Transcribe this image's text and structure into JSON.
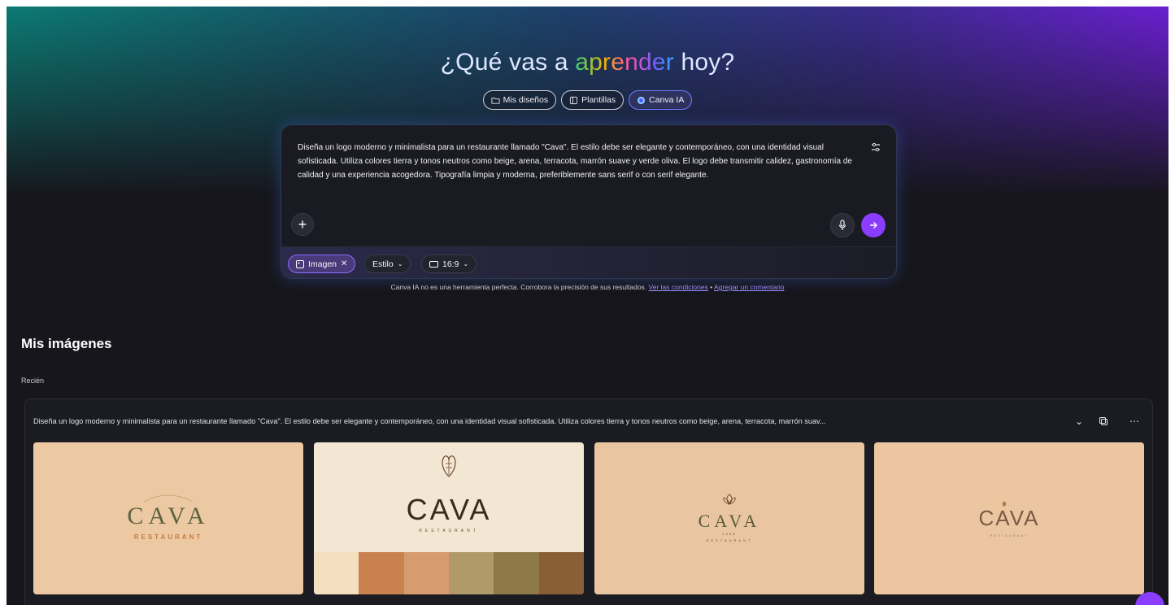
{
  "hero": {
    "headline_prefix": "¿Qué vas a ",
    "headline_accent": "aprender",
    "headline_suffix": " hoy?"
  },
  "tabs": [
    {
      "label": "Mis diseños",
      "icon": "folder-icon"
    },
    {
      "label": "Plantillas",
      "icon": "template-icon"
    },
    {
      "label": "Canva IA",
      "icon": "canva-ai-icon",
      "active": true
    }
  ],
  "prompt": {
    "text": "Diseña un logo moderno y minimalista para un restaurante llamado \"Cava\". El estilo debe ser elegante y contemporáneo, con una identidad visual sofisticada. Utiliza colores tierra y tonos neutros como beige, arena, terracota, marrón suave y verde oliva. El logo debe transmitir calidez, gastronomía de calidad y una experiencia acogedora. Tipografía limpia y moderna, preferiblemente sans serif o con serif elegante."
  },
  "options": {
    "image_chip": "Imagen",
    "style_chip": "Estilo",
    "ratio_chip": "16:9"
  },
  "disclaimer": {
    "text": "Canva IA no es una herramienta perfecta. Corrobora la precisión de sus resultados.",
    "link1": "Ver las condiciones",
    "separator": " • ",
    "link2": "Agregar un comentario"
  },
  "section": {
    "title": "Mis imágenes",
    "subtitle": "Recién"
  },
  "result": {
    "prompt_preview": "Diseña un logo moderno y minimalista para un restaurante llamado \"Cava\". El estilo debe ser elegante y contemporáneo, con una identidad visual sofisticada. Utiliza colores tierra y tonos neutros como beige, arena, terracota, marrón suav..."
  },
  "thumbnails": [
    {
      "logo": "CAVA",
      "sub": "RESTAURANT",
      "arc": "RESTAURANT"
    },
    {
      "logo": "CAVA",
      "sub": "RESTAURANT"
    },
    {
      "logo": "CAVA",
      "sub": "RESTAURANT",
      "tiny": "1998"
    },
    {
      "logo": "CAVA",
      "sub": "RESTAURANT"
    }
  ],
  "palette": [
    "#f4dfbf",
    "#c9824e",
    "#d69c6f",
    "#b19a6a",
    "#8e7a48",
    "#8a5e36"
  ],
  "colors": {
    "accent": "#8b3dff",
    "background": "#16161c",
    "olive": "#59603f",
    "terracotta": "#c47c4a",
    "brown": "#6b4a2f"
  }
}
